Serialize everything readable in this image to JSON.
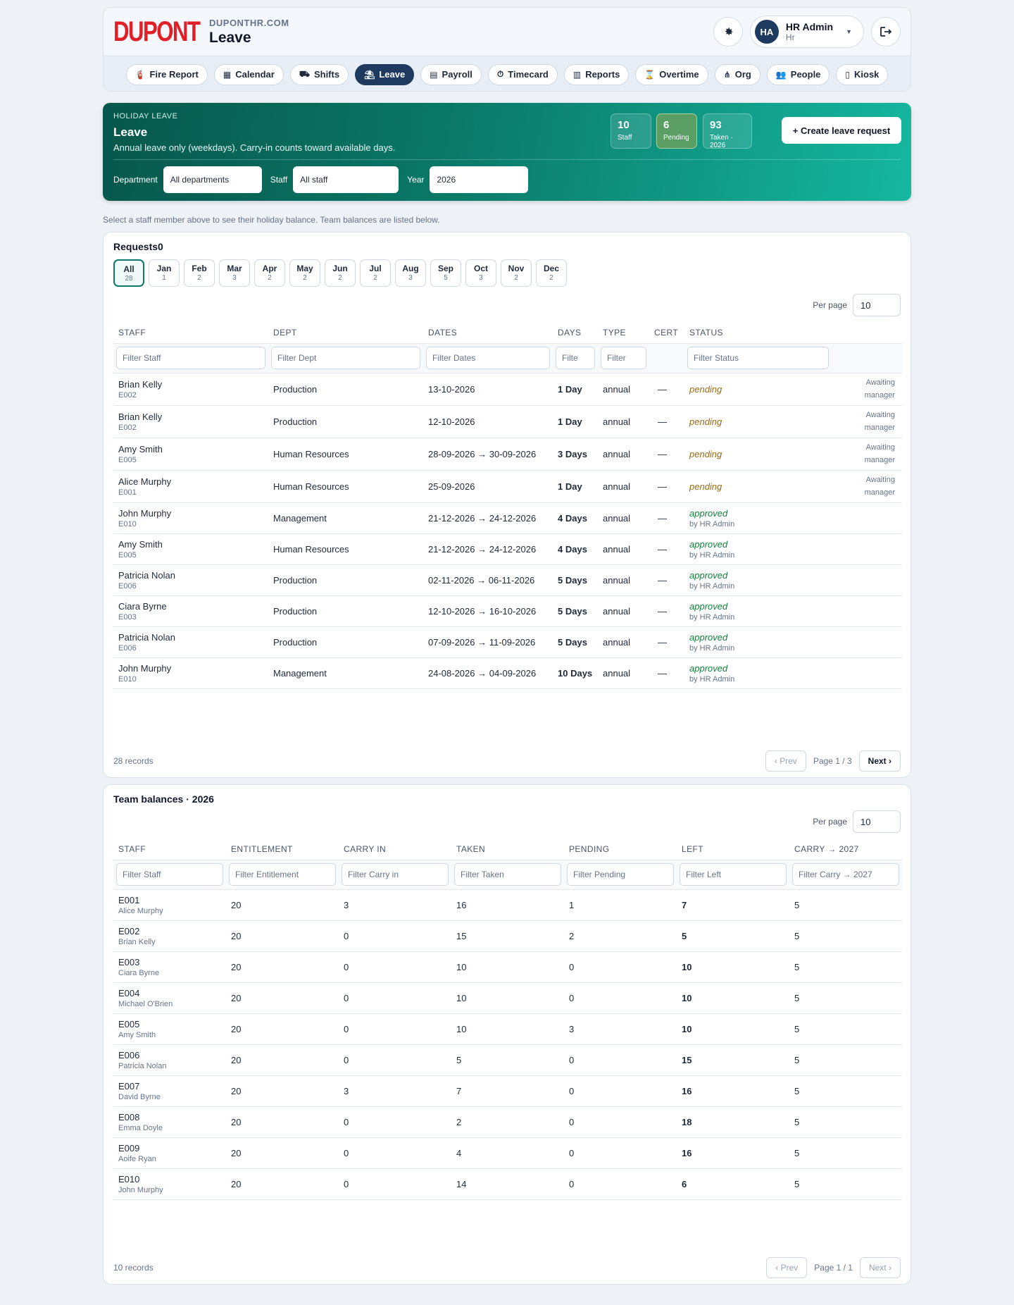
{
  "header": {
    "logo_text": "DUPONT",
    "domain": "DUPONTHR.COM",
    "title": "Leave",
    "user": {
      "initials": "HA",
      "name": "HR Admin",
      "role": "Hr"
    }
  },
  "nav": [
    {
      "label": "Fire Report",
      "icon": "fire-extinguisher-icon",
      "glyph": "🧯"
    },
    {
      "label": "Calendar",
      "icon": "calendar-icon",
      "glyph": "▦"
    },
    {
      "label": "Shifts",
      "icon": "shifts-icon",
      "glyph": "⛟"
    },
    {
      "label": "Leave",
      "icon": "beach-umbrella-icon",
      "glyph": "⛱",
      "active": true
    },
    {
      "label": "Payroll",
      "icon": "payroll-icon",
      "glyph": "▤"
    },
    {
      "label": "Timecard",
      "icon": "stopwatch-icon",
      "glyph": "⏱"
    },
    {
      "label": "Reports",
      "icon": "chart-icon",
      "glyph": "▥"
    },
    {
      "label": "Overtime",
      "icon": "hourglass-icon",
      "glyph": "⌛"
    },
    {
      "label": "Org",
      "icon": "org-chart-icon",
      "glyph": "⋔"
    },
    {
      "label": "People",
      "icon": "people-icon",
      "glyph": "👥"
    },
    {
      "label": "Kiosk",
      "icon": "tablet-icon",
      "glyph": "▯"
    }
  ],
  "hero": {
    "eyebrow": "HOLIDAY LEAVE",
    "title": "Leave",
    "subtitle": "Annual leave only (weekdays). Carry-in counts toward available days.",
    "stats": [
      {
        "value": "10",
        "label": "Staff"
      },
      {
        "value": "6",
        "label": "Pending"
      },
      {
        "value": "93",
        "label": "Taken · 2026"
      }
    ],
    "create_label": "+ Create leave request",
    "filters": {
      "department_label": "Department",
      "department_value": "All departments",
      "staff_label": "Staff",
      "staff_value": "All staff",
      "year_label": "Year",
      "year_value": "2026"
    }
  },
  "hint": "Select a staff member above to see their holiday balance. Team balances are listed below.",
  "requests": {
    "title": "Requests0",
    "months": [
      {
        "name": "All",
        "count": "28",
        "active": true
      },
      {
        "name": "Jan",
        "count": "1"
      },
      {
        "name": "Feb",
        "count": "2"
      },
      {
        "name": "Mar",
        "count": "3"
      },
      {
        "name": "Apr",
        "count": "2"
      },
      {
        "name": "May",
        "count": "2"
      },
      {
        "name": "Jun",
        "count": "2"
      },
      {
        "name": "Jul",
        "count": "2"
      },
      {
        "name": "Aug",
        "count": "3"
      },
      {
        "name": "Sep",
        "count": "5"
      },
      {
        "name": "Oct",
        "count": "3"
      },
      {
        "name": "Nov",
        "count": "2"
      },
      {
        "name": "Dec",
        "count": "2"
      }
    ],
    "per_page_label": "Per page",
    "per_page_value": "10",
    "columns": [
      "STAFF",
      "DEPT",
      "DATES",
      "DAYS",
      "TYPE",
      "CERT",
      "STATUS",
      ""
    ],
    "filters": [
      "Filter Staff",
      "Filter Dept",
      "Filter Dates",
      "Filte",
      "Filter",
      "",
      "Filter Status",
      ""
    ],
    "rows": [
      {
        "name": "Brian Kelly",
        "id": "E002",
        "dept": "Production",
        "dates": "13-10-2026",
        "days": "1 Day",
        "type": "annual",
        "cert": "—",
        "status": "pending",
        "by": "",
        "note1": "Awaiting",
        "note2": "manager"
      },
      {
        "name": "Brian Kelly",
        "id": "E002",
        "dept": "Production",
        "dates": "12-10-2026",
        "days": "1 Day",
        "type": "annual",
        "cert": "—",
        "status": "pending",
        "by": "",
        "note1": "Awaiting",
        "note2": "manager"
      },
      {
        "name": "Amy Smith",
        "id": "E005",
        "dept": "Human Resources",
        "dates": "28-09-2026 → 30-09-2026",
        "days": "3 Days",
        "type": "annual",
        "cert": "—",
        "status": "pending",
        "by": "",
        "note1": "Awaiting",
        "note2": "manager"
      },
      {
        "name": "Alice Murphy",
        "id": "E001",
        "dept": "Human Resources",
        "dates": "25-09-2026",
        "days": "1 Day",
        "type": "annual",
        "cert": "—",
        "status": "pending",
        "by": "",
        "note1": "Awaiting",
        "note2": "manager"
      },
      {
        "name": "John Murphy",
        "id": "E010",
        "dept": "Management",
        "dates": "21-12-2026 → 24-12-2026",
        "days": "4 Days",
        "type": "annual",
        "cert": "—",
        "status": "approved",
        "by": "by HR Admin",
        "note1": "",
        "note2": ""
      },
      {
        "name": "Amy Smith",
        "id": "E005",
        "dept": "Human Resources",
        "dates": "21-12-2026 → 24-12-2026",
        "days": "4 Days",
        "type": "annual",
        "cert": "—",
        "status": "approved",
        "by": "by HR Admin",
        "note1": "",
        "note2": ""
      },
      {
        "name": "Patricia Nolan",
        "id": "E006",
        "dept": "Production",
        "dates": "02-11-2026 → 06-11-2026",
        "days": "5 Days",
        "type": "annual",
        "cert": "—",
        "status": "approved",
        "by": "by HR Admin",
        "note1": "",
        "note2": ""
      },
      {
        "name": "Ciara Byrne",
        "id": "E003",
        "dept": "Production",
        "dates": "12-10-2026 → 16-10-2026",
        "days": "5 Days",
        "type": "annual",
        "cert": "—",
        "status": "approved",
        "by": "by HR Admin",
        "note1": "",
        "note2": ""
      },
      {
        "name": "Patricia Nolan",
        "id": "E006",
        "dept": "Production",
        "dates": "07-09-2026 → 11-09-2026",
        "days": "5 Days",
        "type": "annual",
        "cert": "—",
        "status": "approved",
        "by": "by HR Admin",
        "note1": "",
        "note2": ""
      },
      {
        "name": "John Murphy",
        "id": "E010",
        "dept": "Management",
        "dates": "24-08-2026 → 04-09-2026",
        "days": "10 Days",
        "type": "annual",
        "cert": "—",
        "status": "approved",
        "by": "by HR Admin",
        "note1": "",
        "note2": ""
      }
    ],
    "records": "28 records",
    "prev": "‹ Prev",
    "page": "Page 1 / 3",
    "next": "Next ›"
  },
  "balances": {
    "title": "Team balances · 2026",
    "per_page_label": "Per page",
    "per_page_value": "10",
    "columns": [
      "STAFF",
      "ENTITLEMENT",
      "CARRY IN",
      "TAKEN",
      "PENDING",
      "LEFT",
      "CARRY → 2027"
    ],
    "filters": [
      "Filter Staff",
      "Filter Entitlement",
      "Filter Carry in",
      "Filter Taken",
      "Filter Pending",
      "Filter Left",
      "Filter Carry → 2027"
    ],
    "rows": [
      {
        "id": "E001",
        "name": "Alice Murphy",
        "entitlement": "20",
        "carry_in": "3",
        "taken": "16",
        "pending": "1",
        "left": "7",
        "carry_out": "5"
      },
      {
        "id": "E002",
        "name": "Brian Kelly",
        "entitlement": "20",
        "carry_in": "0",
        "taken": "15",
        "pending": "2",
        "left": "5",
        "carry_out": "5"
      },
      {
        "id": "E003",
        "name": "Ciara Byrne",
        "entitlement": "20",
        "carry_in": "0",
        "taken": "10",
        "pending": "0",
        "left": "10",
        "carry_out": "5"
      },
      {
        "id": "E004",
        "name": "Michael O'Brien",
        "entitlement": "20",
        "carry_in": "0",
        "taken": "10",
        "pending": "0",
        "left": "10",
        "carry_out": "5"
      },
      {
        "id": "E005",
        "name": "Amy Smith",
        "entitlement": "20",
        "carry_in": "0",
        "taken": "10",
        "pending": "3",
        "left": "10",
        "carry_out": "5"
      },
      {
        "id": "E006",
        "name": "Patricia Nolan",
        "entitlement": "20",
        "carry_in": "0",
        "taken": "5",
        "pending": "0",
        "left": "15",
        "carry_out": "5"
      },
      {
        "id": "E007",
        "name": "David Byrne",
        "entitlement": "20",
        "carry_in": "3",
        "taken": "7",
        "pending": "0",
        "left": "16",
        "carry_out": "5"
      },
      {
        "id": "E008",
        "name": "Emma Doyle",
        "entitlement": "20",
        "carry_in": "0",
        "taken": "2",
        "pending": "0",
        "left": "18",
        "carry_out": "5"
      },
      {
        "id": "E009",
        "name": "Aoife Ryan",
        "entitlement": "20",
        "carry_in": "0",
        "taken": "4",
        "pending": "0",
        "left": "16",
        "carry_out": "5"
      },
      {
        "id": "E010",
        "name": "John Murphy",
        "entitlement": "20",
        "carry_in": "0",
        "taken": "14",
        "pending": "0",
        "left": "6",
        "carry_out": "5"
      }
    ],
    "records": "10 records",
    "prev": "‹ Prev",
    "page": "Page 1 / 1",
    "next": "Next ›"
  },
  "colors": {
    "brand_red": "#e01f26",
    "navy": "#1e3a5f",
    "teal": "#0b7a69",
    "pending": "#9a6a12",
    "approved": "#15803d"
  }
}
